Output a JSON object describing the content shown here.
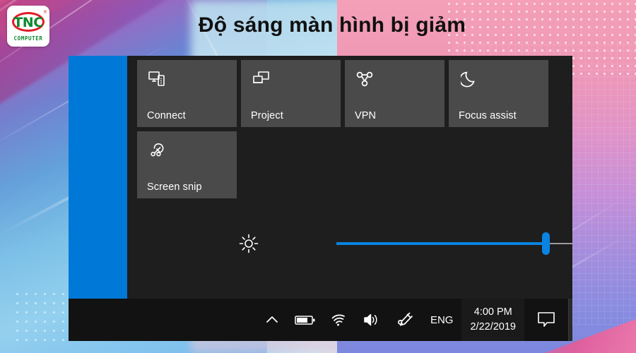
{
  "header": {
    "title": "Độ sáng màn hình bị giảm",
    "logo": {
      "mark": "TNC",
      "registered": "®",
      "subtitle": "COMPUTER",
      "green": "#0e8a2e",
      "red": "#e01b24"
    }
  },
  "action_center": {
    "accent_color": "#0078d7",
    "panel_bg": "#1e1e1e",
    "tile_bg": "#4a4a4a",
    "tiles": [
      {
        "label": "Connect",
        "icon": "connect-icon"
      },
      {
        "label": "Project",
        "icon": "project-icon"
      },
      {
        "label": "VPN",
        "icon": "vpn-icon"
      },
      {
        "label": "Focus assist",
        "icon": "moon-icon"
      },
      {
        "label": "Screen snip",
        "icon": "screen-snip-icon"
      }
    ],
    "brightness": {
      "icon": "brightness-icon",
      "value": 74,
      "min": 0,
      "max": 100,
      "fill_color": "#0a84e0",
      "track_color": "#9a9a9a"
    }
  },
  "taskbar": {
    "bg": "#121212",
    "tray_icons": [
      {
        "name": "show-hidden-icons-chevron-icon"
      },
      {
        "name": "battery-icon"
      },
      {
        "name": "wifi-icon"
      },
      {
        "name": "volume-icon"
      },
      {
        "name": "pen-workspace-icon"
      }
    ],
    "language": "ENG",
    "clock": {
      "time": "4:00 PM",
      "date": "2/22/2019"
    },
    "notification_icon": "notification-bubble-icon"
  }
}
